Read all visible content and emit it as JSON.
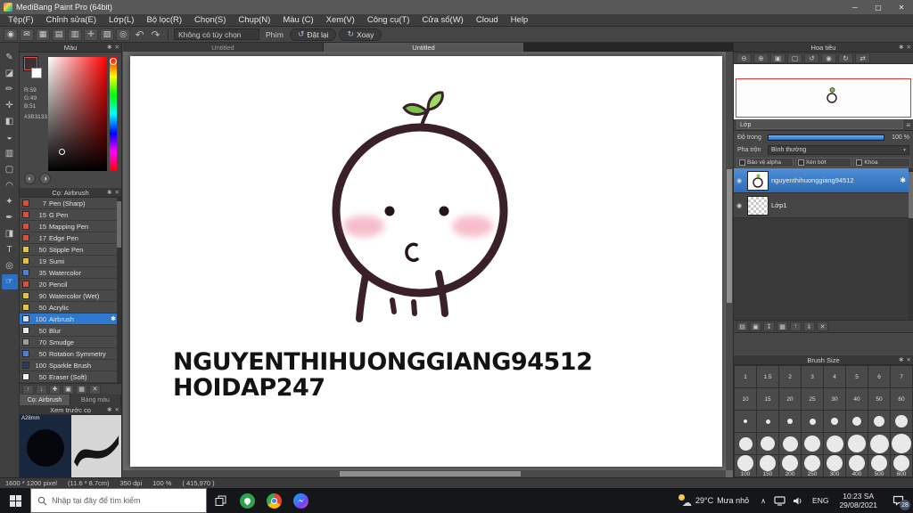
{
  "icons": {
    "gear": "✱",
    "close": "✕",
    "minimize": "─",
    "maximize": "▢",
    "undo": "↶",
    "redo": "↷",
    "menu": "≡",
    "caret_down": "▾",
    "chevron_up": "∧",
    "eye": "◉",
    "reset": "↺",
    "rotate": "↻",
    "cloud": "☁"
  },
  "window": {
    "title": "MediBang Paint Pro (64bit)"
  },
  "menubar": {
    "items": [
      "Tệp(F)",
      "Chỉnh sửa(E)",
      "Lớp(L)",
      "Bộ lọc(R)",
      "Chọn(S)",
      "Chụp(N)",
      "Màu (C)",
      "Xem(V)",
      "Công cụ(T)",
      "Cửa sổ(W)",
      "Cloud",
      "Help"
    ]
  },
  "toolbar": {
    "icons": [
      {
        "name": "account-icon",
        "glyph": "◉"
      },
      {
        "name": "comment-icon",
        "glyph": "✉"
      },
      {
        "name": "material-panel-icon",
        "glyph": "▦"
      },
      {
        "name": "grid-view-icon",
        "glyph": "▤"
      },
      {
        "name": "ruler-parallel-icon",
        "glyph": "▥"
      },
      {
        "name": "ruler-cross-icon",
        "glyph": "✛"
      },
      {
        "name": "ruler-vanishing-icon",
        "glyph": "▧"
      },
      {
        "name": "ruler-ellipse-icon",
        "glyph": "◎"
      }
    ],
    "options_dropdown": "Không có tùy chọn",
    "key_label": "Phím",
    "reset_button": "Đặt lại",
    "rotate_button": "Xoay"
  },
  "document_tabs": [
    {
      "label": "Untitled"
    },
    {
      "label": "Untitled",
      "active": true
    }
  ],
  "tools": [
    {
      "name": "brush-tool",
      "glyph": "✎"
    },
    {
      "name": "eraser-tool",
      "glyph": "◪"
    },
    {
      "name": "dot-pen-tool",
      "glyph": "✏"
    },
    {
      "name": "move-tool",
      "glyph": "✛"
    },
    {
      "name": "fill-tool",
      "glyph": "◧"
    },
    {
      "name": "bucket-tool",
      "glyph": "◒"
    },
    {
      "name": "gradient-tool",
      "glyph": "▥"
    },
    {
      "name": "select-tool",
      "glyph": "▢"
    },
    {
      "name": "lasso-tool",
      "glyph": "◠"
    },
    {
      "name": "magic-wand-tool",
      "glyph": "✦"
    },
    {
      "name": "select-pen-tool",
      "glyph": "✒"
    },
    {
      "name": "select-eraser-tool",
      "glyph": "◨"
    },
    {
      "name": "text-tool",
      "glyph": "T"
    },
    {
      "name": "eyedropper-tool",
      "glyph": "◎"
    },
    {
      "name": "hand-tool",
      "glyph": "☞",
      "selected": true
    }
  ],
  "color_panel": {
    "title": "Màu",
    "r_label": "R:59",
    "g_label": "G:49",
    "b_label": "B:51",
    "hex_label": "#3B3133",
    "foreground_color": "#3b3133",
    "background_color": "#ffffff",
    "buttons": [
      {
        "name": "color-wheel-button",
        "glyph": "◐"
      },
      {
        "name": "color-dial-button",
        "glyph": "◑"
      }
    ]
  },
  "brush_panel": {
    "title": "Cọ: Airbrush",
    "items": [
      {
        "size": "7",
        "name": "Pen (Sharp)",
        "color": "#d7503c"
      },
      {
        "size": "15",
        "name": "G Pen",
        "color": "#d7503c"
      },
      {
        "size": "15",
        "name": "Mapping Pen",
        "color": "#d7503c"
      },
      {
        "size": "17",
        "name": "Edge Pen",
        "color": "#d7503c"
      },
      {
        "size": "50",
        "name": "Stipple Pen",
        "color": "#e3c53d"
      },
      {
        "size": "19",
        "name": "Sumi",
        "color": "#e3c53d"
      },
      {
        "size": "35",
        "name": "Watercolor",
        "color": "#4e7fd0"
      },
      {
        "size": "20",
        "name": "Pencil",
        "color": "#d7503c"
      },
      {
        "size": "90",
        "name": "Watercolor (Wet)",
        "color": "#e3c53d"
      },
      {
        "size": "50",
        "name": "Acrylic",
        "color": "#e3c53d"
      },
      {
        "size": "100",
        "name": "Airbrush",
        "color": "#cfe3f5",
        "selected": true
      },
      {
        "size": "50",
        "name": "Blur",
        "color": "#e8e8e8"
      },
      {
        "size": "70",
        "name": "Smudge",
        "color": "#9b9b9b"
      },
      {
        "size": "50",
        "name": "Rotation Symmetry",
        "color": "#4e7fd0"
      },
      {
        "size": "100",
        "name": "Sparkle Brush",
        "color": "#2c3a5c"
      },
      {
        "size": "50",
        "name": "Eraser (Soft)",
        "color": "#f2f2f2"
      }
    ],
    "buttons": [
      {
        "name": "move-brush-up-button",
        "glyph": "↑"
      },
      {
        "name": "move-brush-down-button",
        "glyph": "↓"
      },
      {
        "name": "add-brush-button",
        "glyph": "✚"
      },
      {
        "name": "duplicate-brush-button",
        "glyph": "▣"
      },
      {
        "name": "brush-folder-button",
        "glyph": "▦"
      },
      {
        "name": "delete-brush-button",
        "glyph": "✕"
      }
    ],
    "tabs": [
      {
        "label": "Cọ: Airbrush",
        "active": true
      },
      {
        "label": "Bảng màu"
      }
    ]
  },
  "brush_preview": {
    "title": "Xem trước cọ",
    "size_label": "A28mm"
  },
  "canvas": {
    "watermark_line1": "NGUYENTHIHUONGGIANG94512",
    "watermark_line2": "HOIDAP247"
  },
  "navigator": {
    "title": "Hoa tiêu",
    "buttons": [
      {
        "name": "zoom-out-button",
        "glyph": "⊖"
      },
      {
        "name": "zoom-in-button",
        "glyph": "⊕"
      },
      {
        "name": "fit-window-button",
        "glyph": "▣"
      },
      {
        "name": "actual-pixels-button",
        "glyph": "▢"
      },
      {
        "name": "rotate-left-button",
        "glyph": "↺"
      },
      {
        "name": "reset-view-button",
        "glyph": "◉"
      },
      {
        "name": "rotate-right-button",
        "glyph": "↻"
      },
      {
        "name": "flip-view-button",
        "glyph": "⇄"
      }
    ]
  },
  "layers_panel": {
    "title": "Lớp",
    "opacity_label": "Độ trong",
    "opacity_value": "100 %",
    "blend_label": "Pha trộn",
    "blend_value": "Bình thường",
    "checkboxes": [
      {
        "name": "protect-alpha-checkbox",
        "label": "Bảo vệ alpha"
      },
      {
        "name": "clipping-checkbox",
        "label": "Xén bớt"
      },
      {
        "name": "lock-checkbox",
        "label": "Khóa"
      }
    ],
    "layers": [
      {
        "name": "nguyenthihuonggiang94512",
        "selected": true
      },
      {
        "name": "Lớp1"
      }
    ],
    "buttons": [
      {
        "name": "new-layer-button",
        "glyph": "▤"
      },
      {
        "name": "duplicate-layer-button",
        "glyph": "▣"
      },
      {
        "name": "transfer-layer-button",
        "glyph": "↧"
      },
      {
        "name": "new-folder-button",
        "glyph": "▦"
      },
      {
        "name": "move-layer-up-button",
        "glyph": "↑"
      },
      {
        "name": "merge-layer-button",
        "glyph": "⇓"
      },
      {
        "name": "delete-layer-button",
        "glyph": "✕"
      }
    ]
  },
  "brush_size_panel": {
    "title": "Brush Size",
    "cells": [
      {
        "label": "1"
      },
      {
        "label": "1.5"
      },
      {
        "label": "2"
      },
      {
        "label": "3"
      },
      {
        "label": "4"
      },
      {
        "label": "5"
      },
      {
        "label": "6"
      },
      {
        "label": "7"
      },
      {
        "label": "10"
      },
      {
        "label": "15"
      },
      {
        "label": "20"
      },
      {
        "label": "25"
      },
      {
        "label": "30"
      },
      {
        "label": "40"
      },
      {
        "label": "50"
      },
      {
        "label": "60"
      },
      {
        "d": "4px"
      },
      {
        "d": "5px"
      },
      {
        "d": "6px"
      },
      {
        "d": "7px"
      },
      {
        "d": "8px"
      },
      {
        "d": "10px"
      },
      {
        "d": "12px"
      },
      {
        "d": "14px"
      },
      {
        "d": "15px"
      },
      {
        "d": "16px"
      },
      {
        "d": "17px"
      },
      {
        "d": "18px"
      },
      {
        "d": "19px"
      },
      {
        "d": "20px"
      },
      {
        "d": "21px"
      },
      {
        "d": "22px"
      },
      {
        "d": "18px",
        "label": "100"
      },
      {
        "d": "18px",
        "label": "150"
      },
      {
        "d": "18px",
        "label": "200"
      },
      {
        "d": "18px",
        "label": "250"
      },
      {
        "d": "18px",
        "label": "300"
      },
      {
        "d": "18px",
        "label": "400"
      },
      {
        "d": "18px",
        "label": "500"
      },
      {
        "d": "18px",
        "label": "600"
      }
    ]
  },
  "statusbar": {
    "size_text": "1600 * 1200 pixel",
    "cm_text": "(11.6 * 8.7cm)",
    "dpi_text": "350 dpi",
    "zoom": "100 %",
    "coords": "( 415,970 )"
  },
  "taskbar": {
    "search_placeholder": "Nhập tại đây để tìm kiếm",
    "weather_temp": "29°C",
    "weather_desc": "Mưa nhỏ",
    "language": "ENG",
    "time": "10:23 SA",
    "date": "29/08/2021",
    "notification_count": "28"
  }
}
